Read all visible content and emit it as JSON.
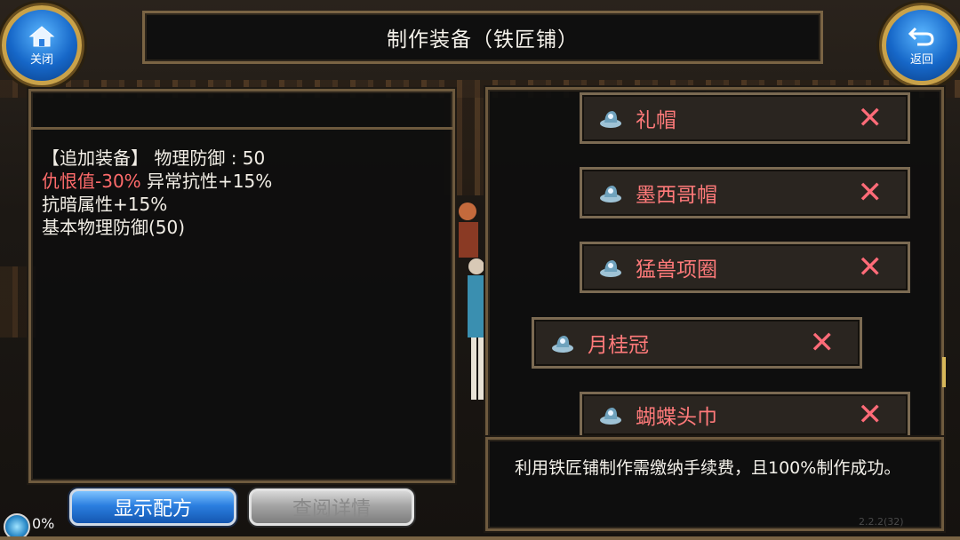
{
  "window": {
    "title": "制作装备（铁匠铺）"
  },
  "nav": {
    "close_label": "关闭",
    "back_label": "返回"
  },
  "stats": {
    "line1": "【追加装备】 物理防御 :  50",
    "line2_red": "仇恨值-30%",
    "line2_rest": " 异常抗性+15%",
    "line3": "抗暗属性+15%",
    "line4": "基本物理防御(50)"
  },
  "recipe_list": [
    {
      "name": "礼帽",
      "icon": "hat-icon"
    },
    {
      "name": "墨西哥帽",
      "icon": "hat-icon"
    },
    {
      "name": "猛兽项圈",
      "icon": "hat-icon"
    },
    {
      "name": "月桂冠",
      "icon": "hat-icon",
      "selected": true
    },
    {
      "name": "蝴蝶头巾",
      "icon": "hat-icon"
    }
  ],
  "description": "利用铁匠铺制作需缴纳手续费，且100%制作成功。",
  "buttons": {
    "show_recipe": "显示配方",
    "view_details": "查阅详情"
  },
  "status": {
    "load_percent": "0%",
    "version": "2.2.2(32)"
  },
  "colors": {
    "accent_blue": "#2b7fe0",
    "red_text": "#ff6b6b",
    "frame_gold": "#7a6444"
  }
}
